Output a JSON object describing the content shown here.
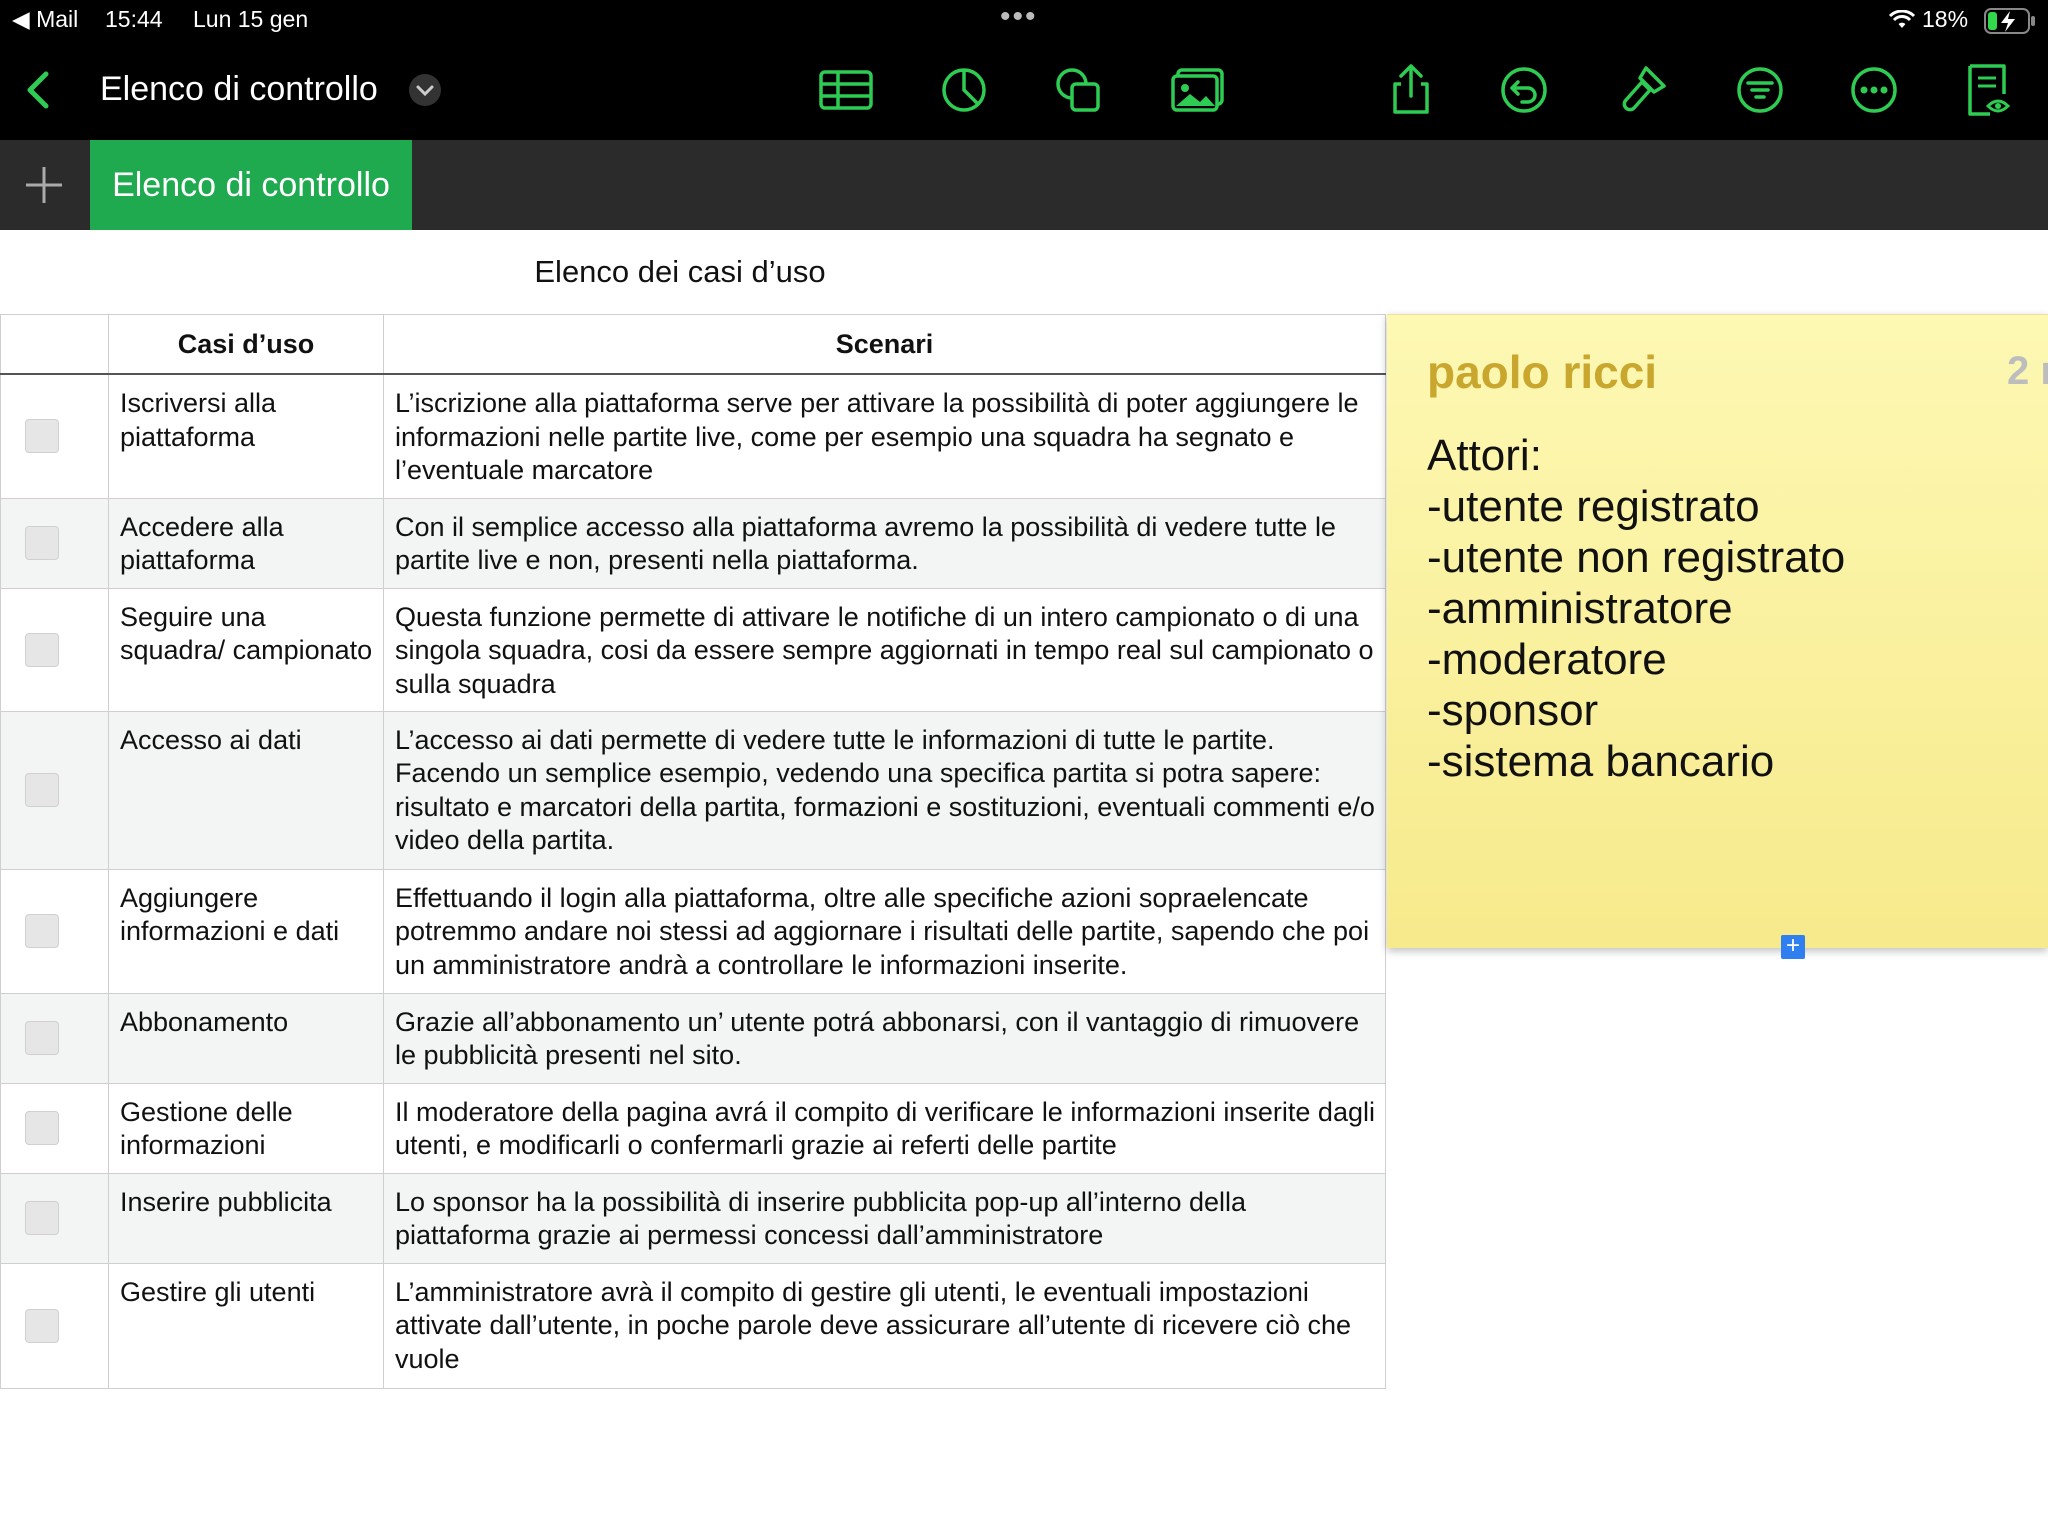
{
  "status_bar": {
    "back_app": "◀ Mail",
    "time": "15:44",
    "date": "Lun 15 gen",
    "battery": "18%"
  },
  "toolbar": {
    "document_title": "Elenco di controllo",
    "accent_color": "#2ecc52",
    "icons": [
      "back-chevron-icon",
      "title-dropdown-icon",
      "table-icon",
      "chart-icon",
      "shapes-icon",
      "media-icon",
      "share-icon",
      "undo-icon",
      "format-brush-icon",
      "organize-icon",
      "more-icon",
      "reading-view-icon"
    ]
  },
  "sheet_tabs": {
    "add_label": "+",
    "active_tab": "Elenco di controllo",
    "tab_color": "#1faa4f"
  },
  "table": {
    "title": "Elenco dei casi d’uso",
    "headers": [
      "",
      "Casi d’uso",
      "Scenari"
    ],
    "rows": [
      {
        "checked": false,
        "case": "Iscriversi alla piattaforma",
        "scenario": "L’iscrizione alla piattaforma serve per attivare la possibilità di poter aggiungere le informazioni nelle partite live, come per esempio una squadra ha segnato e l’eventuale marcatore"
      },
      {
        "checked": false,
        "case": "Accedere alla piattaforma",
        "scenario": "Con il semplice accesso alla piattaforma avremo la possibilità di vedere tutte le partite live e non, presenti nella piattaforma."
      },
      {
        "checked": false,
        "case": "Seguire una squadra/ campionato",
        "scenario": "Questa funzione permette di attivare le notifiche di un intero campionato o di una singola squadra, cosi da essere sempre aggiornati in tempo real sul campionato o sulla squadra"
      },
      {
        "checked": false,
        "case": "Accesso ai dati",
        "scenario": "L’accesso ai dati permette di vedere tutte le informazioni di tutte le partite. Facendo un semplice esempio,  vedendo una specifica partita si potra sapere: risultato e marcatori della partita, formazioni e sostituzioni, eventuali commenti e/o video della partita."
      },
      {
        "checked": false,
        "case": "Aggiungere informazioni e dati",
        "scenario": "Effettuando il login alla piattaforma, oltre alle specifiche azioni sopraelencate potremmo andare noi stessi ad aggiornare i risultati delle partite, sapendo che poi un amministratore andrà a controllare le informazioni inserite."
      },
      {
        "checked": false,
        "case": "Abbonamento",
        "scenario": "Grazie all’abbonamento un’ utente potrá abbonarsi, con il vantaggio di rimuovere le pubblicità presenti nel sito."
      },
      {
        "checked": false,
        "case": "Gestione delle informazioni",
        "scenario": "Il moderatore della pagina avrá il compito di verificare le informazioni inserite dagli utenti, e modificarli o confermarli grazie ai referti delle partite"
      },
      {
        "checked": false,
        "case": "Inserire pubblicita",
        "scenario": "Lo sponsor ha la possibilità di inserire pubblicita pop-up all’interno della piattaforma grazie ai permessi concessi dall’amministratore"
      },
      {
        "checked": false,
        "case": "Gestire gli utenti",
        "scenario": "L’amministratore avrà il compito di gestire gli utenti, le eventuali impostazioni attivate dall’utente, in poche parole deve assicurare all’utente di ricevere ciò che vuole"
      }
    ]
  },
  "comment_note": {
    "author": "paolo ricci",
    "count": "2 r",
    "body": "Attori:\n-utente registrato\n-utente non registrato\n-amministratore\n-moderatore\n-sponsor\n-sistema bancario",
    "background": "#fdf5a6"
  }
}
